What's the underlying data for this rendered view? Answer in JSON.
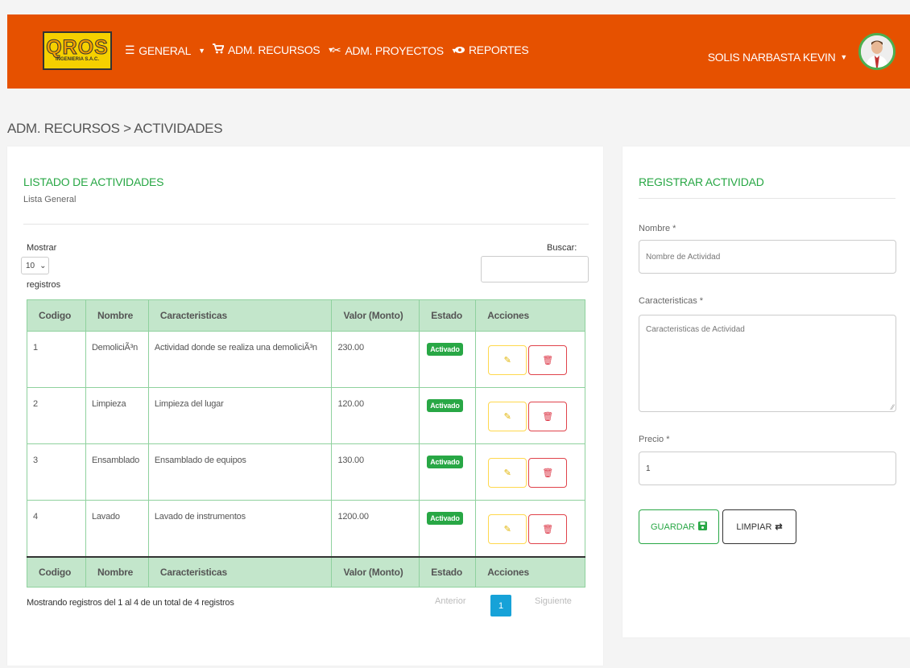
{
  "brand": {
    "logo_main": "QROS",
    "logo_sub": "INGENIERIA S.A.C."
  },
  "nav": {
    "general": "GENERAL",
    "recursos": "ADM. RECURSOS",
    "proyectos": "ADM. PROYECTOS",
    "reportes": "REPORTES",
    "user": "SOLIS NARBASTA KEVIN"
  },
  "breadcrumb": "ADM. RECURSOS > ACTIVIDADES",
  "list": {
    "title": "LISTADO DE ACTIVIDADES",
    "subtitle": "Lista General",
    "show_label": "Mostrar",
    "page_size": "10",
    "records_label": "registros",
    "search_label": "Buscar:",
    "columns": [
      "Codigo",
      "Nombre",
      "Caracteristicas",
      "Valor (Monto)",
      "Estado",
      "Acciones"
    ],
    "rows": [
      {
        "codigo": "1",
        "nombre": "DemoliciÃ³n",
        "caracteristicas": "Actividad donde se realiza una demoliciÃ³n",
        "valor": "230.00",
        "estado": "Activado"
      },
      {
        "codigo": "2",
        "nombre": "Limpieza",
        "caracteristicas": "Limpieza del lugar",
        "valor": "120.00",
        "estado": "Activado"
      },
      {
        "codigo": "3",
        "nombre": "Ensamblado",
        "caracteristicas": "Ensamblado de equipos",
        "valor": "130.00",
        "estado": "Activado"
      },
      {
        "codigo": "4",
        "nombre": "Lavado",
        "caracteristicas": "Lavado de instrumentos",
        "valor": "1200.00",
        "estado": "Activado"
      }
    ],
    "info": "Mostrando registros del 1 al 4 de un total de 4 registros",
    "prev": "Anterior",
    "page": "1",
    "next": "Siguiente"
  },
  "form": {
    "title": "REGISTRAR ACTIVIDAD",
    "nombre_label": "Nombre *",
    "nombre_placeholder": "Nombre de Actividad",
    "carac_label": "Caracteristicas *",
    "carac_placeholder": "Caracteristicas de Actividad",
    "precio_label": "Precio *",
    "precio_value": "1",
    "save": "GUARDAR",
    "clear": "LIMPIAR"
  },
  "colors": {
    "navbar": "#e65100",
    "accent": "#28a745",
    "table_header": "#c3e6cb",
    "pagination": "#17a2d8"
  }
}
